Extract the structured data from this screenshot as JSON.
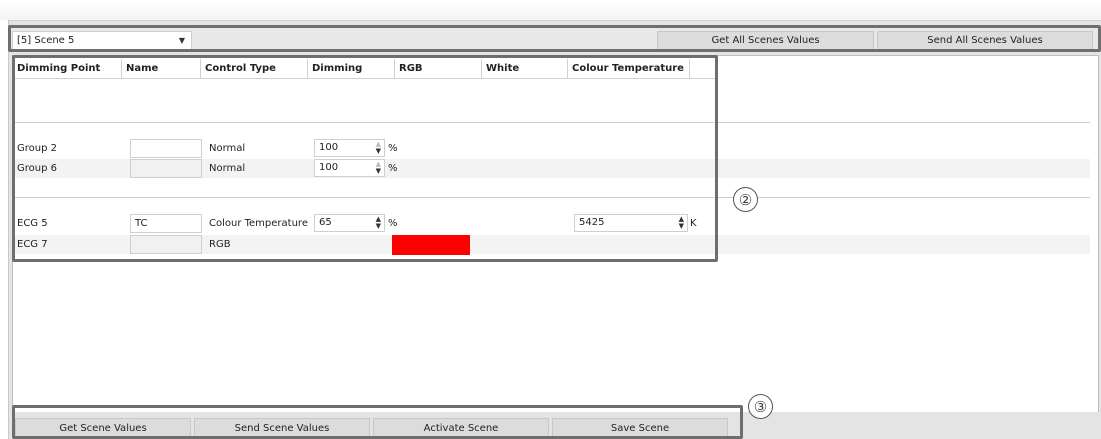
{
  "scene_selector": {
    "value": "[5] Scene 5"
  },
  "toolbar": {
    "get_all_label": "Get All Scenes Values",
    "send_all_label": "Send All Scenes Values"
  },
  "table": {
    "columns": [
      "Dimming Point",
      "Name",
      "Control Type",
      "Dimming",
      "RGB",
      "White",
      "Colour Temperature"
    ],
    "rows": [
      {
        "point": "Group 2",
        "name": "",
        "control": "Normal",
        "dimming": "100",
        "dimming_unit": "%"
      },
      {
        "point": "Group 6",
        "name": "",
        "control": "Normal",
        "dimming": "100",
        "dimming_unit": "%"
      },
      {
        "point": "ECG 5",
        "name": "TC",
        "control": "Colour Temperature",
        "dimming": "65",
        "dimming_unit": "%",
        "colour_temp": "5425",
        "colour_temp_unit": "K"
      },
      {
        "point": "ECG 7",
        "name": "",
        "control": "RGB",
        "rgb_color": "#ff0000"
      }
    ]
  },
  "markers": {
    "m2": "②",
    "m3": "③"
  },
  "bottom": {
    "get_label": "Get Scene Values",
    "send_label": "Send Scene Values",
    "activate_label": "Activate Scene",
    "save_label": "Save Scene"
  },
  "colors": {
    "highlight": "#6e6e6e",
    "rgb_swatch": "#ff0000"
  }
}
